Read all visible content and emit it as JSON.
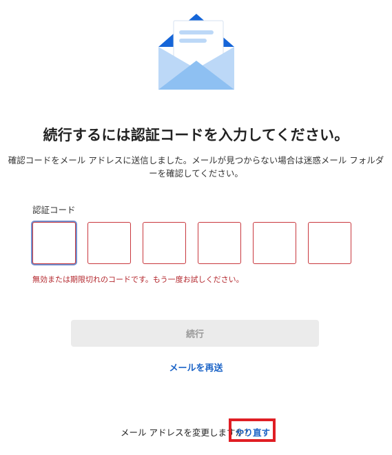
{
  "icons": {
    "envelope": "open-envelope-illustration"
  },
  "colors": {
    "accent": "#1a63c7",
    "error": "#c8363c",
    "highlight_box": "#e01e24",
    "envelope_light": "#bcd8f7",
    "envelope_dark": "#1565d8"
  },
  "main": {
    "title": "続行するには認証コードを入力してください。",
    "description": "確認コードをメール アドレスに送信しました。メールが見つからない場合は迷惑メール フォルダーを確認してください。"
  },
  "code_input": {
    "label": "認証コード",
    "boxes": [
      "",
      "",
      "",
      "",
      "",
      ""
    ],
    "error_message": "無効または期限切れのコードです。もう一度お試しください。"
  },
  "actions": {
    "continue_label": "続行",
    "resend_label": "メールを再送"
  },
  "footer": {
    "prompt": "メール アドレスを変更しますか?",
    "retry_label": "やり直す"
  }
}
